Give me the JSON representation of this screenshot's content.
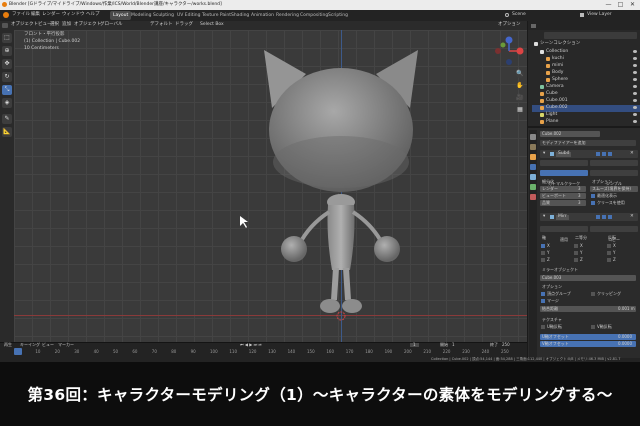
{
  "os_window": {
    "title": "Blender [Gドライブ/マイドライブ/Windows/作業/ICS/World/Blender講座/キャラクター/works.blend]",
    "minimize": "—",
    "maximize": "□",
    "close": "✕"
  },
  "topbar": {
    "menus": [
      "ファイル",
      "編集",
      "レンダー",
      "ウィンドウ",
      "ヘルプ"
    ],
    "workspaces": [
      "Layout",
      "Modeling",
      "Sculpting",
      "UV Editing",
      "Texture Paint",
      "Shading",
      "Animation",
      "Rendering",
      "Compositing",
      "Scripting"
    ],
    "active_workspace": "Layout",
    "scene": "Scene",
    "view_layer": "View Layer"
  },
  "viewport_header": {
    "mode": "オブジェクト",
    "menus": [
      "ビュー",
      "選択",
      "追加",
      "オブジェクト"
    ],
    "orientation": "グローバル",
    "pivot": "デフォルト",
    "drag": "ドラッグ",
    "select": "Select Box",
    "options": "オプション"
  },
  "viewport_overlay": {
    "view_name": "フロント・平行投影",
    "collection": "(1) Collection | Cube.002",
    "units": "10 Centimeters"
  },
  "outliner": {
    "title": "シーンコレクション",
    "items": [
      {
        "label": "Collection",
        "indent": 0,
        "color": "#e0e0e0"
      },
      {
        "label": "kuchi",
        "indent": 1,
        "color": "#e8a24a"
      },
      {
        "label": "mimi",
        "indent": 1,
        "color": "#e8a24a"
      },
      {
        "label": "Body",
        "indent": 1,
        "color": "#e8a24a"
      },
      {
        "label": "Sphere",
        "indent": 1,
        "color": "#e8a24a"
      },
      {
        "label": "Camera",
        "indent": 0,
        "color": "#7fc3a0"
      },
      {
        "label": "Cube",
        "indent": 0,
        "color": "#e8a24a"
      },
      {
        "label": "Cube.001",
        "indent": 0,
        "color": "#e8a24a"
      },
      {
        "label": "Cube.002",
        "indent": 0,
        "color": "#e8a24a"
      },
      {
        "label": "Light",
        "indent": 0,
        "color": "#d6d66a"
      },
      {
        "label": "Plane",
        "indent": 0,
        "color": "#e8a24a"
      }
    ]
  },
  "properties": {
    "object_name": "Cube.002",
    "add_modifier": "モディファイアーを追加",
    "subsurf": {
      "name": "Subd",
      "apply": "適用",
      "copy": "コピー",
      "catmull": "カトマルクラーク",
      "simple": "シンプル",
      "subdiv_label": "細分化",
      "options_label": "オプション",
      "render_label": "レンダー",
      "render_value": "3",
      "viewport_label": "ビューポート",
      "viewport_value": "3",
      "quality_label": "品質",
      "quality_value": "3",
      "uv_smooth": "スムーズ(境界を保持)",
      "optimal": "最適化表示",
      "crease": "クリースを使用"
    },
    "mirror": {
      "name": "Mirr",
      "apply": "適用",
      "copy": "コピー",
      "axis_label": "軸",
      "bisect_label": "二等分",
      "flip_label": "反転",
      "x": "X",
      "y": "Y",
      "z": "Z",
      "mirror_object_label": "ミラーオブジェクト",
      "mirror_object": "Cube.003",
      "options_label": "オプション",
      "vertex_groups": "頂点グループ",
      "clipping": "クリッピング",
      "merge": "マージ",
      "merge_dist_label": "結合距離",
      "merge_dist": "0.001 m",
      "texture_label": "テクスチャ",
      "u_mirror": "U軸反転",
      "v_mirror": "V軸反転",
      "u_offset_label": "U軸オフセット",
      "u_offset": "0.0000",
      "v_offset_label": "V軸オフセット",
      "v_offset": "0.0000"
    }
  },
  "timeline": {
    "menus": [
      "再生",
      "キーイング",
      "ビュー",
      "マーカー"
    ],
    "ticks": [
      "0",
      "10",
      "20",
      "30",
      "40",
      "50",
      "60",
      "70",
      "80",
      "90",
      "100",
      "110",
      "120",
      "130",
      "140",
      "150",
      "160",
      "170",
      "180",
      "190",
      "200",
      "210",
      "220",
      "230",
      "240",
      "250"
    ],
    "current_frame": "1",
    "start_label": "開始",
    "start": "1",
    "end_label": "終了",
    "end": "250"
  },
  "statusbar": {
    "text": "Collection | Cube.002 | 頂点:54,144 | 面:54,288 | 三角面:112,440 | オブジェクト:0/8 | メモリ:46.3 MiB | v2.81.7"
  },
  "caption": "第36回：キャラクターモデリング（1）〜キャラクターの素体をモデリングする〜",
  "colors": {
    "accent": "#4772b3",
    "header": "#232323",
    "viewport": "#3a3a3a"
  }
}
